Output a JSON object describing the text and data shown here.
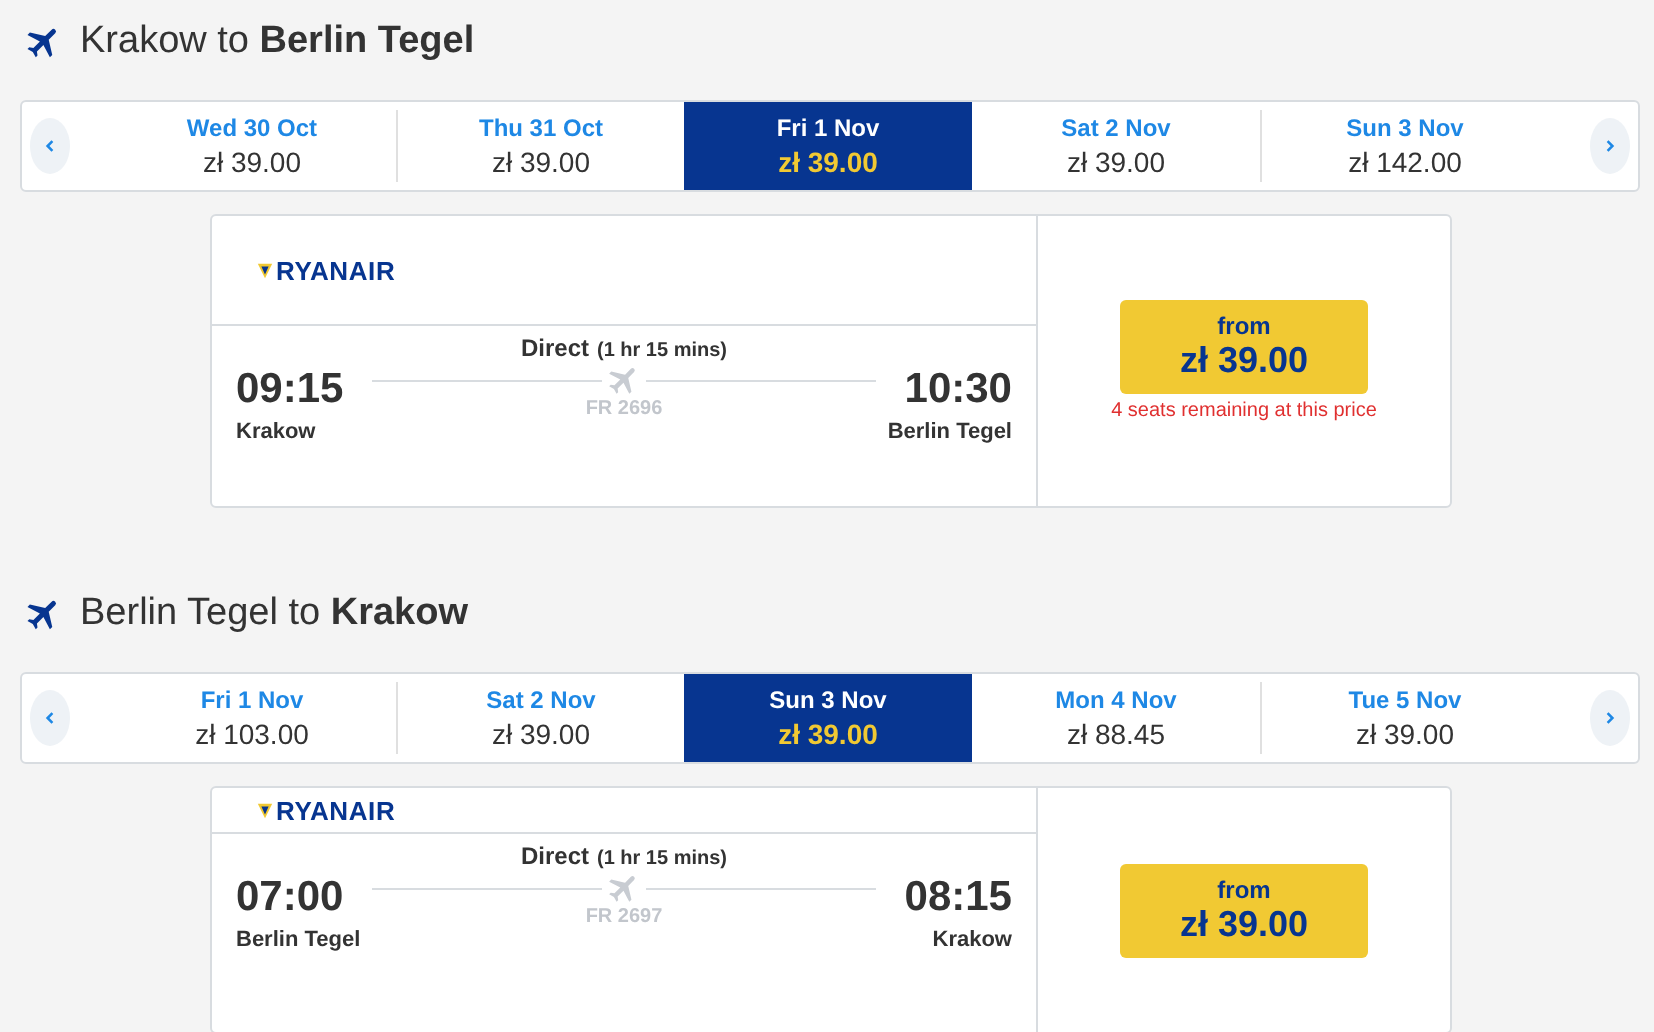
{
  "journeys": [
    {
      "title": "Krakow to **Berlin Tegel**",
      "dates": [
        {
          "label": "Wed 30 Oct",
          "price": "zł 39.00",
          "selected": false
        },
        {
          "label": "Thu 31 Oct",
          "price": "zł 39.00",
          "selected": false
        },
        {
          "label": "Fri 1 Nov",
          "price": "zł 39.00",
          "selected": true
        },
        {
          "label": "Sat 2 Nov",
          "price": "zł 39.00",
          "selected": false
        },
        {
          "label": "Sun 3 Nov",
          "price": "zł 142.00",
          "selected": false
        }
      ],
      "flight": {
        "airline": "RYANAIR",
        "direct": "Direct",
        "duration": "(1 hr 15 mins)",
        "depart_time": "09:15",
        "depart_city": "Krakow",
        "arrive_time": "10:30",
        "arrive_city": "Berlin Tegel",
        "flight_number": "FR 2696",
        "from": "from",
        "price": "zł 39.00",
        "seats_note": "4 seats remaining at this price"
      }
    },
    {
      "title": "Berlin Tegel to **Krakow**",
      "dates": [
        {
          "label": "Fri 1 Nov",
          "price": "zł 103.00",
          "selected": false
        },
        {
          "label": "Sat 2 Nov",
          "price": "zł 39.00",
          "selected": false
        },
        {
          "label": "Sun 3 Nov",
          "price": "zł 39.00",
          "selected": true
        },
        {
          "label": "Mon 4 Nov",
          "price": "zł 88.45",
          "selected": false
        },
        {
          "label": "Tue 5 Nov",
          "price": "zł 39.00",
          "selected": false
        }
      ],
      "flight": {
        "airline": "RYANAIR",
        "direct": "Direct",
        "duration": "(1 hr 15 mins)",
        "depart_time": "07:00",
        "depart_city": "Berlin Tegel",
        "arrive_time": "08:15",
        "arrive_city": "Krakow",
        "flight_number": "FR 2697",
        "from": "from",
        "price": "zł 39.00"
      }
    }
  ]
}
